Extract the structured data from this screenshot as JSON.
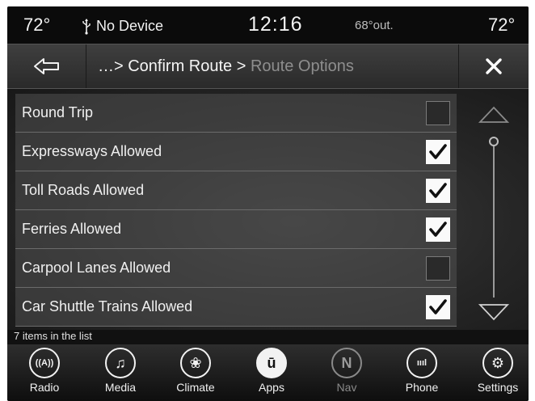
{
  "status": {
    "temp_left": "72°",
    "usb_text": "No Device",
    "clock": "12:16",
    "outside_temp": "68°out.",
    "temp_right": "72°"
  },
  "header": {
    "breadcrumb_prefix": "…> Confirm Route > ",
    "breadcrumb_current": "Route Options",
    "back_icon": "back-arrow-icon",
    "close_icon": "close-icon"
  },
  "list": {
    "items": [
      {
        "label": "Round Trip",
        "checked": false
      },
      {
        "label": "Expressways Allowed",
        "checked": true
      },
      {
        "label": "Toll Roads Allowed",
        "checked": true
      },
      {
        "label": "Ferries Allowed",
        "checked": true
      },
      {
        "label": "Carpool Lanes Allowed",
        "checked": false
      },
      {
        "label": "Car Shuttle Trains Allowed",
        "checked": true
      }
    ],
    "count_text": "7 items in the list"
  },
  "nav": {
    "items": [
      {
        "label": "Radio",
        "icon": "radio-icon",
        "glyph": "((A))",
        "enabled": true
      },
      {
        "label": "Media",
        "icon": "music-note-icon",
        "glyph": "♫",
        "enabled": true
      },
      {
        "label": "Climate",
        "icon": "climate-icon",
        "glyph": "❀",
        "enabled": true
      },
      {
        "label": "Apps",
        "icon": "apps-icon",
        "glyph": "ū",
        "enabled": true
      },
      {
        "label": "Nav",
        "icon": "compass-icon",
        "glyph": "N",
        "enabled": false
      },
      {
        "label": "Phone",
        "icon": "phone-signal-icon",
        "glyph": "ıııl",
        "enabled": true
      },
      {
        "label": "Settings",
        "icon": "gear-icon",
        "glyph": "⚙",
        "enabled": true
      }
    ]
  },
  "colors": {
    "checked_box": "#fafafa",
    "unchecked_box": "#2a2a2a",
    "disabled_text": "#8a8a8a"
  }
}
